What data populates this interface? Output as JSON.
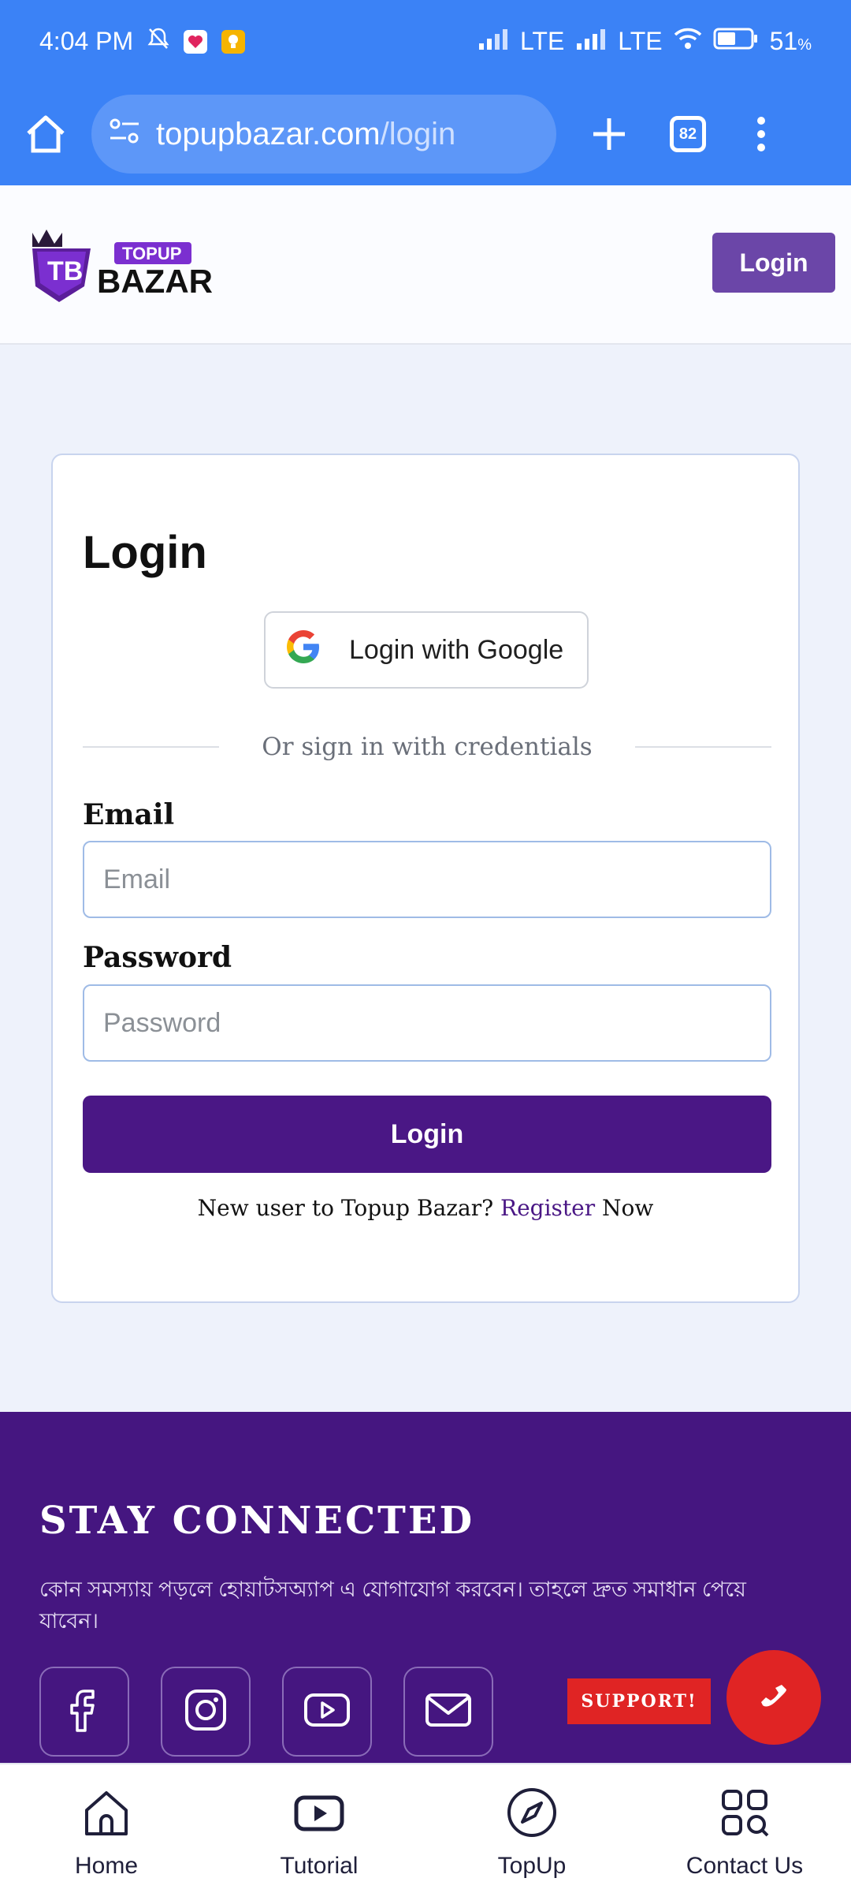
{
  "status_bar": {
    "time": "4:04 PM",
    "network_1": "LTE",
    "network_2": "LTE",
    "battery": "51",
    "battery_unit": "%"
  },
  "browser": {
    "url_domain": "topupbazar.com",
    "url_path": "/login",
    "tab_count": "82"
  },
  "header": {
    "logo_topup": "TOPUP",
    "logo_bazar": "BAZAR",
    "login_label": "Login"
  },
  "login_card": {
    "title": "Login",
    "google_label": "Login with Google",
    "divider_text": "Or sign in with credentials",
    "email_label": "Email",
    "email_placeholder": "Email",
    "password_label": "Password",
    "password_placeholder": "Password",
    "submit_label": "Login",
    "register_prefix": "New user to Topup Bazar?",
    "register_link": "Register",
    "register_suffix": "Now"
  },
  "footer": {
    "title": "STAY CONNECTED",
    "text": "কোন সমস্যায় পড়লে হোয়াটসঅ্যাপ এ যোগাযোগ করবেন। তাহলে দ্রুত সমাধান পেয়ে যাবেন।",
    "socials": [
      "facebook-icon",
      "instagram-icon",
      "youtube-icon",
      "email-icon"
    ],
    "support_label": "SUPPORT!"
  },
  "bottom_nav": {
    "items": [
      {
        "label": "Home",
        "icon": "home-icon"
      },
      {
        "label": "Tutorial",
        "icon": "play-icon"
      },
      {
        "label": "TopUp",
        "icon": "compass-icon"
      },
      {
        "label": "Contact Us",
        "icon": "grid-icon"
      }
    ]
  },
  "colors": {
    "browser_blue": "#3b82f6",
    "brand_purple": "#4a1785",
    "header_button": "#6b46a8",
    "footer_bg": "#451680",
    "support_red": "#e02424"
  }
}
